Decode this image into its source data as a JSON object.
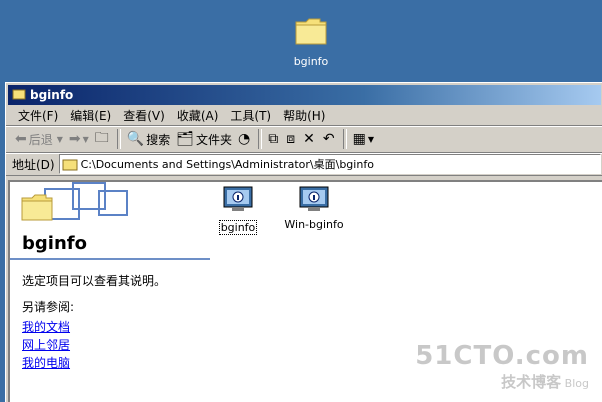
{
  "desktop": {
    "folder_label": "bginfo"
  },
  "window": {
    "title": "bginfo"
  },
  "menu": [
    "文件(F)",
    "编辑(E)",
    "查看(V)",
    "收藏(A)",
    "工具(T)",
    "帮助(H)"
  ],
  "toolbar": {
    "back_label": "后退",
    "search_label": "搜索",
    "folders_label": "文件夹"
  },
  "address": {
    "label": "地址(D)",
    "value": "C:\\Documents and Settings\\Administrator\\桌面\\bginfo"
  },
  "sidebar": {
    "title": "bginfo",
    "description": "选定项目可以查看其说明。",
    "see_also": "另请参阅:",
    "links": [
      "我的文档",
      "网上邻居",
      "我的电脑"
    ]
  },
  "files": [
    {
      "name": "bginfo",
      "selected": true
    },
    {
      "name": "Win-bginfo",
      "selected": false
    }
  ],
  "watermark": {
    "line1": "51CTO.com",
    "line2": "技术博客",
    "line3": "Blog"
  },
  "colors": {
    "desktop": "#3a6ea5",
    "title_start": "#0a246a",
    "title_end": "#a6caf0",
    "link": "#0000ee"
  }
}
